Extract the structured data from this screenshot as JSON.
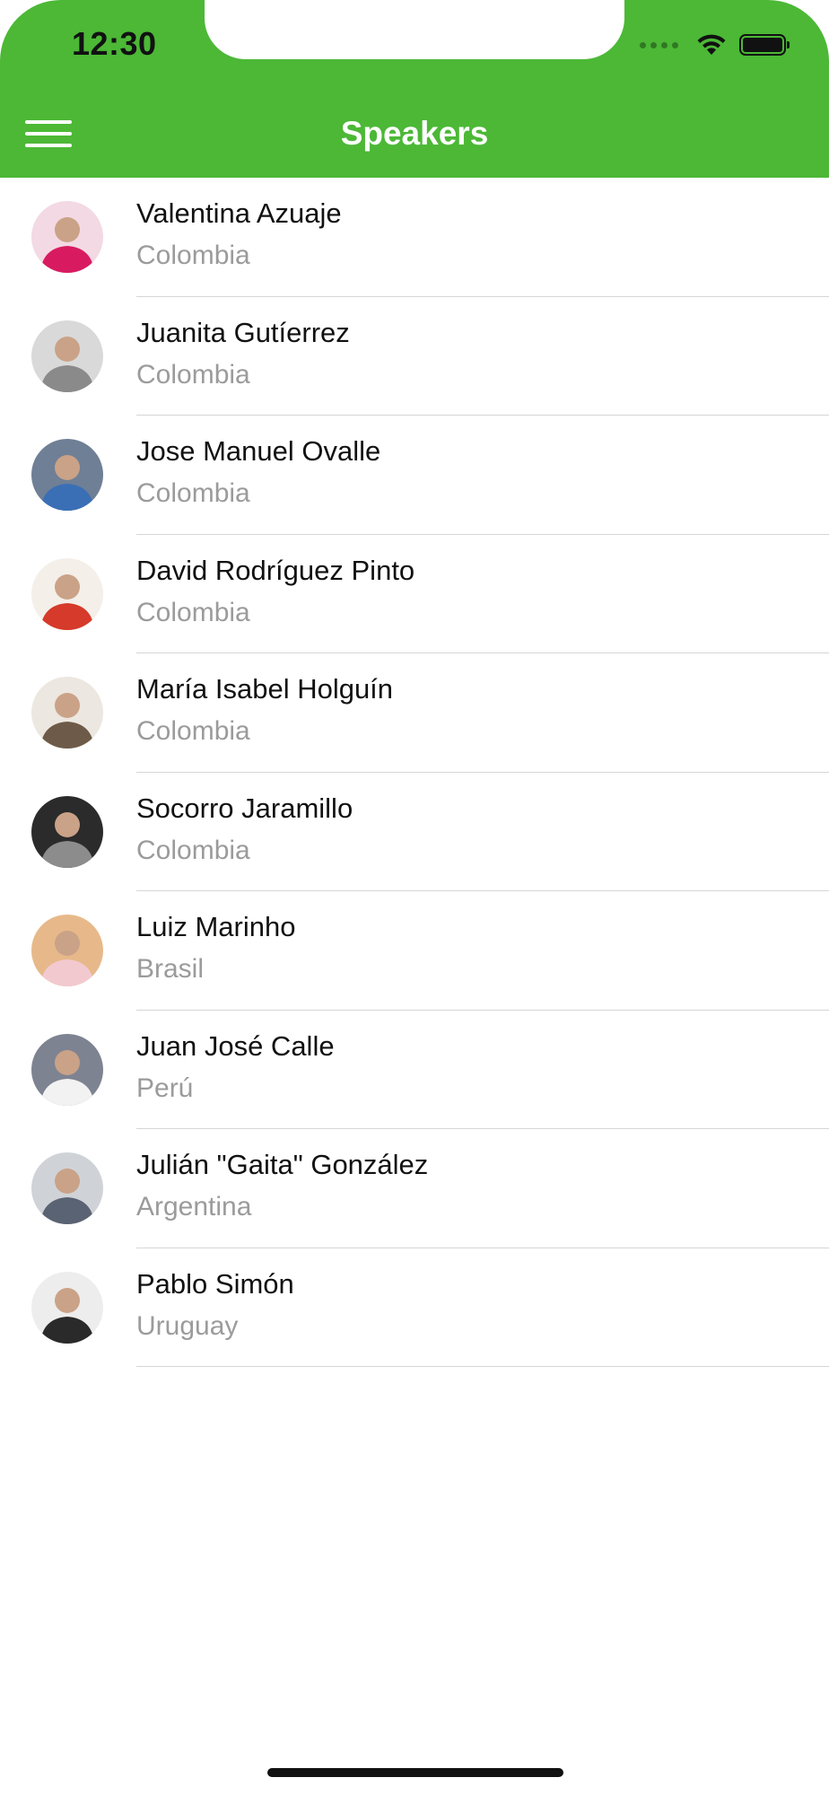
{
  "status_bar": {
    "time": "12:30"
  },
  "header": {
    "title": "Speakers",
    "color": "#4cb836"
  },
  "speakers": [
    {
      "name": "Valentina Azuaje",
      "country": "Colombia",
      "avatar": "valentina-azuaje-photo",
      "avatar_colors": [
        "#f3d9e3",
        "#d81b60"
      ]
    },
    {
      "name": "Juanita Gutíerrez",
      "country": "Colombia",
      "avatar": "juanita-gutierrez-photo",
      "avatar_colors": [
        "#d9d9d9",
        "#8a8a8a"
      ]
    },
    {
      "name": "Jose Manuel Ovalle",
      "country": "Colombia",
      "avatar": "jose-manuel-ovalle-photo",
      "avatar_colors": [
        "#6f7f95",
        "#3a6fb6"
      ]
    },
    {
      "name": "David Rodríguez Pinto",
      "country": "Colombia",
      "avatar": "david-rodriguez-pinto-photo",
      "avatar_colors": [
        "#f4efe9",
        "#d63a2a"
      ]
    },
    {
      "name": "María Isabel Holguín",
      "country": "Colombia",
      "avatar": "maria-isabel-holguin-photo",
      "avatar_colors": [
        "#ece7e0",
        "#6e5a48"
      ]
    },
    {
      "name": "Socorro Jaramillo",
      "country": "Colombia",
      "avatar": "socorro-jaramillo-photo",
      "avatar_colors": [
        "#2b2b2b",
        "#8c8c8c"
      ]
    },
    {
      "name": "Luiz Marinho",
      "country": "Brasil",
      "avatar": "luiz-marinho-photo",
      "avatar_colors": [
        "#e7b98a",
        "#f2c9cf"
      ]
    },
    {
      "name": "Juan José Calle",
      "country": "Perú",
      "avatar": "juan-jose-calle-photo",
      "avatar_colors": [
        "#7e8391",
        "#f2f2f2"
      ]
    },
    {
      "name": "Julián \"Gaita\" González",
      "country": "Argentina",
      "avatar": "julian-gaita-gonzalez-photo",
      "avatar_colors": [
        "#cfd3d8",
        "#5a6373"
      ]
    },
    {
      "name": "Pablo Simón",
      "country": "Uruguay",
      "avatar": "pablo-simon-photo",
      "avatar_colors": [
        "#ededed",
        "#2a2a2a"
      ]
    }
  ]
}
